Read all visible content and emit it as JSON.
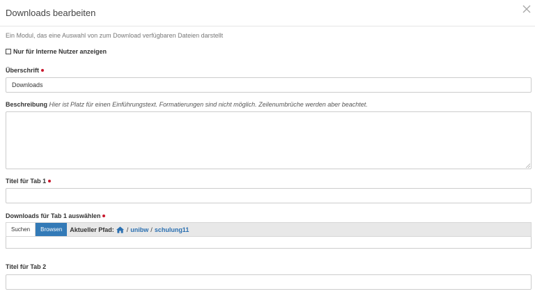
{
  "modal": {
    "title": "Downloads bearbeiten",
    "intro": "Ein Modul, das eine Auswahl von zum Download verfügbaren Dateien darstellt"
  },
  "internal_only": {
    "label": "Nur für Interne Nutzer anzeigen",
    "checked": false
  },
  "heading_field": {
    "label": "Überschrift",
    "value": "Downloads"
  },
  "description_field": {
    "label": "Beschreibung",
    "hint": "Hier ist Platz für einen Einführungstext. Formatierungen sind nicht möglich. Zeilenumbrüche werden aber beachtet.",
    "value": ""
  },
  "tab1_title_field": {
    "label": "Titel für Tab 1",
    "value": ""
  },
  "tab1_downloads": {
    "label": "Downloads für Tab 1 auswählen",
    "search_tab": "Suchen",
    "browse_tab": "Browsen",
    "path_label": "Aktueller Pfad:",
    "path": [
      "unibw",
      "schulung11"
    ]
  },
  "tab2_title_field": {
    "label": "Titel für Tab 2",
    "value": ""
  },
  "colors": {
    "required": "#c9172c",
    "primary": "#337ab7",
    "link": "#2a6fb0"
  }
}
